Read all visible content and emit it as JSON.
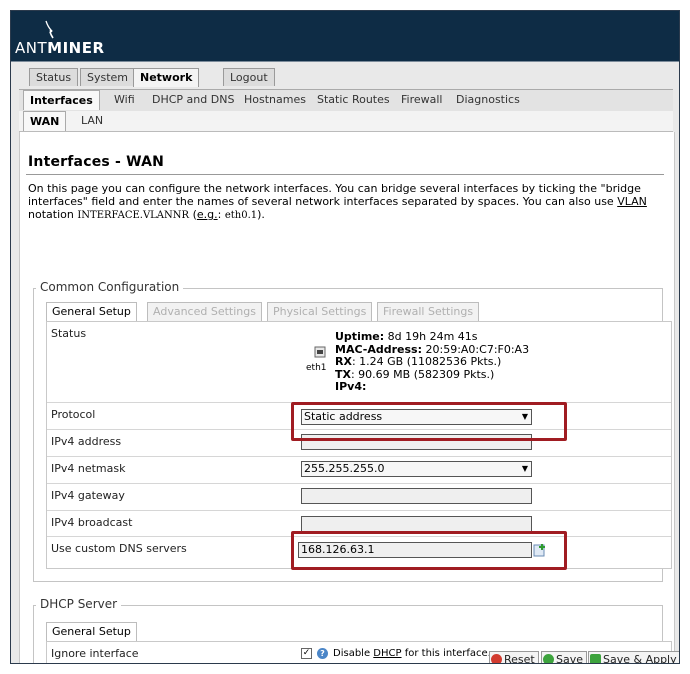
{
  "brand": {
    "prefix": "ANT",
    "suffix": "MINER"
  },
  "top_tabs": [
    "Status",
    "System",
    "Network",
    "Logout"
  ],
  "network_tabs": [
    "Interfaces",
    "Wifi",
    "DHCP and DNS",
    "Hostnames",
    "Static Routes",
    "Firewall",
    "Diagnostics"
  ],
  "iface_tabs": [
    "WAN",
    "LAN"
  ],
  "page": {
    "title": "Interfaces - WAN",
    "desc_line1": "On this page you can configure the network interfaces. You can bridge several interfaces by ticking the \"bridge",
    "desc_line2": "interfaces\" field and enter the names of several network interfaces separated by spaces. You can also use",
    "desc_vlan": "VLAN",
    "desc_line3_a": "notation",
    "desc_code": "INTERFACE.VLANNR",
    "desc_paren_open": "(",
    "desc_eg": "e.g.",
    "desc_colon": ":",
    "desc_example": "eth0.1",
    "desc_paren_close": ")."
  },
  "common": {
    "legend": "Common Configuration",
    "tabs": [
      "General Setup",
      "Advanced Settings",
      "Physical Settings",
      "Firewall Settings"
    ],
    "status_label": "Status",
    "device": "eth1",
    "uptime_label": "Uptime:",
    "uptime_value": "8d 19h 24m 41s",
    "mac_label": "MAC-Address:",
    "mac_value": "20:59:A0:C7:F0:A3",
    "rx_label": "RX",
    "rx_value": ": 1.24 GB (11082536 Pkts.)",
    "tx_label": "TX",
    "tx_value": ": 90.69 MB (582309 Pkts.)",
    "ipv4_label": "IPv4:",
    "protocol_label": "Protocol",
    "protocol_value": "Static address",
    "ipv4_address_label": "IPv4 address",
    "ipv4_address_value": "",
    "netmask_label": "IPv4 netmask",
    "netmask_value": "255.255.255.0",
    "gateway_label": "IPv4 gateway",
    "gateway_value": "",
    "broadcast_label": "IPv4 broadcast",
    "broadcast_value": "",
    "dns_label": "Use custom DNS servers",
    "dns_value": "168.126.63.1"
  },
  "dhcp": {
    "legend": "DHCP Server",
    "tab": "General Setup",
    "ignore_label": "Ignore interface",
    "ignore_checked": true,
    "disable_text_a": "Disable",
    "disable_text_b": "DHCP",
    "disable_text_c": "for this interface."
  },
  "buttons": {
    "reset": "Reset",
    "save": "Save",
    "save_apply": "Save & Apply"
  },
  "colors": {
    "header": "#0e2c45",
    "highlight": "#a01c22"
  }
}
